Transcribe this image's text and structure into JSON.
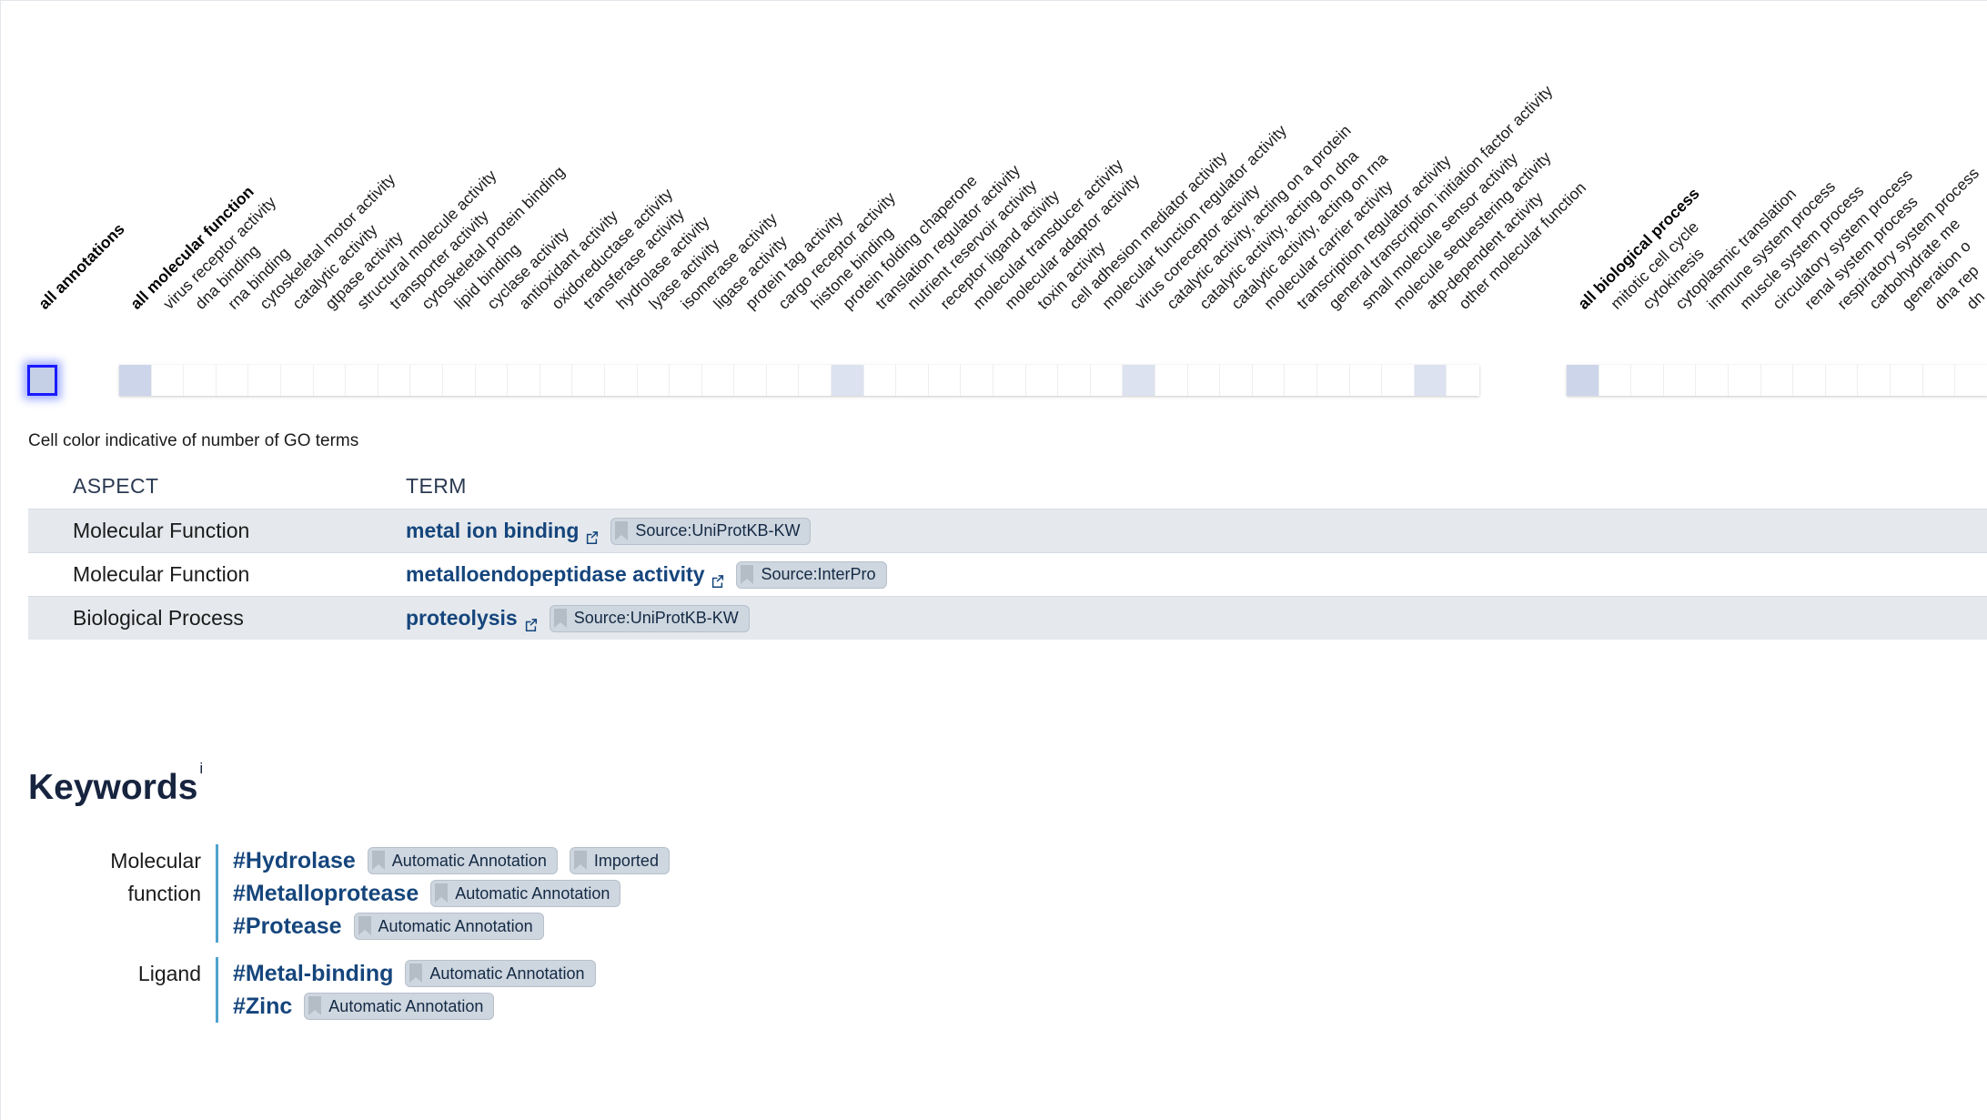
{
  "heatmap": {
    "caption": "Cell color indicative of number of GO terms",
    "groups": [
      {
        "id": "all-annotations",
        "label": "all annotations",
        "bold": true,
        "cells": 1
      },
      {
        "id": "molecular-function",
        "labels": [
          "all molecular function",
          "virus receptor activity",
          "dna binding",
          "rna binding",
          "cytoskeletal motor activity",
          "catalytic activity",
          "gtpase activity",
          "structural molecule activity",
          "transporter activity",
          "cytoskeletal protein binding",
          "lipid binding",
          "cyclase activity",
          "antioxidant activity",
          "oxidoreductase activity",
          "transferase activity",
          "hydrolase activity",
          "lyase activity",
          "isomerase activity",
          "ligase activity",
          "protein tag activity",
          "cargo receptor activity",
          "histone binding",
          "protein folding chaperone",
          "translation regulator activity",
          "nutrient reservoir activity",
          "receptor ligand activity",
          "molecular transducer activity",
          "molecular adaptor activity",
          "toxin activity",
          "cell adhesion mediator activity",
          "molecular function regulator activity",
          "virus coreceptor activity",
          "catalytic activity, acting on a protein",
          "catalytic activity, acting on dna",
          "catalytic activity, acting on rna",
          "molecular carrier activity",
          "transcription regulator activity",
          "general transcription initiation factor activity",
          "small molecule sensor activity",
          "molecule sequestering activity",
          "atp-dependent activity",
          "other molecular function"
        ],
        "filled_indices": [
          0,
          22,
          31,
          40
        ]
      },
      {
        "id": "biological-process",
        "labels": [
          "all biological process",
          "mitotic cell cycle",
          "cytokinesis",
          "cytoplasmic translation",
          "immune system process",
          "muscle system process",
          "circulatory system process",
          "renal system process",
          "respiratory system process",
          "carbohydrate me",
          "generation o",
          "dna rep",
          "dn"
        ],
        "filled_indices": [
          0
        ]
      }
    ]
  },
  "go_table": {
    "headers": {
      "aspect": "ASPECT",
      "term": "TERM"
    },
    "rows": [
      {
        "aspect": "Molecular Function",
        "term": "metal ion binding",
        "badges": [
          "Source:UniProtKB-KW"
        ]
      },
      {
        "aspect": "Molecular Function",
        "term": "metalloendopeptidase activity",
        "badges": [
          "Source:InterPro"
        ]
      },
      {
        "aspect": "Biological Process",
        "term": "proteolysis",
        "badges": [
          "Source:UniProtKB-KW"
        ]
      }
    ]
  },
  "keywords": {
    "title": "Keywords",
    "info_marker": "i",
    "groups": [
      {
        "category": "Molecular function",
        "category_line1": "Molecular",
        "category_line2": "function",
        "items": [
          {
            "name": "#Hydrolase",
            "badges": [
              "Automatic Annotation",
              "Imported"
            ]
          },
          {
            "name": "#Metalloprotease",
            "badges": [
              "Automatic Annotation"
            ]
          },
          {
            "name": "#Protease",
            "badges": [
              "Automatic Annotation"
            ]
          }
        ]
      },
      {
        "category": "Ligand",
        "category_line1": "Ligand",
        "category_line2": "",
        "items": [
          {
            "name": "#Metal-binding",
            "badges": [
              "Automatic Annotation"
            ]
          },
          {
            "name": "#Zinc",
            "badges": [
              "Automatic Annotation"
            ]
          }
        ]
      }
    ]
  },
  "colors": {
    "link": "#15457c",
    "badge_bg": "#ced6df",
    "cell_filled": "#ccd5ea",
    "focus_ring": "#1a1aff",
    "keyword_rule": "#4ea3cd",
    "row_alt": "#e5e9ed"
  }
}
